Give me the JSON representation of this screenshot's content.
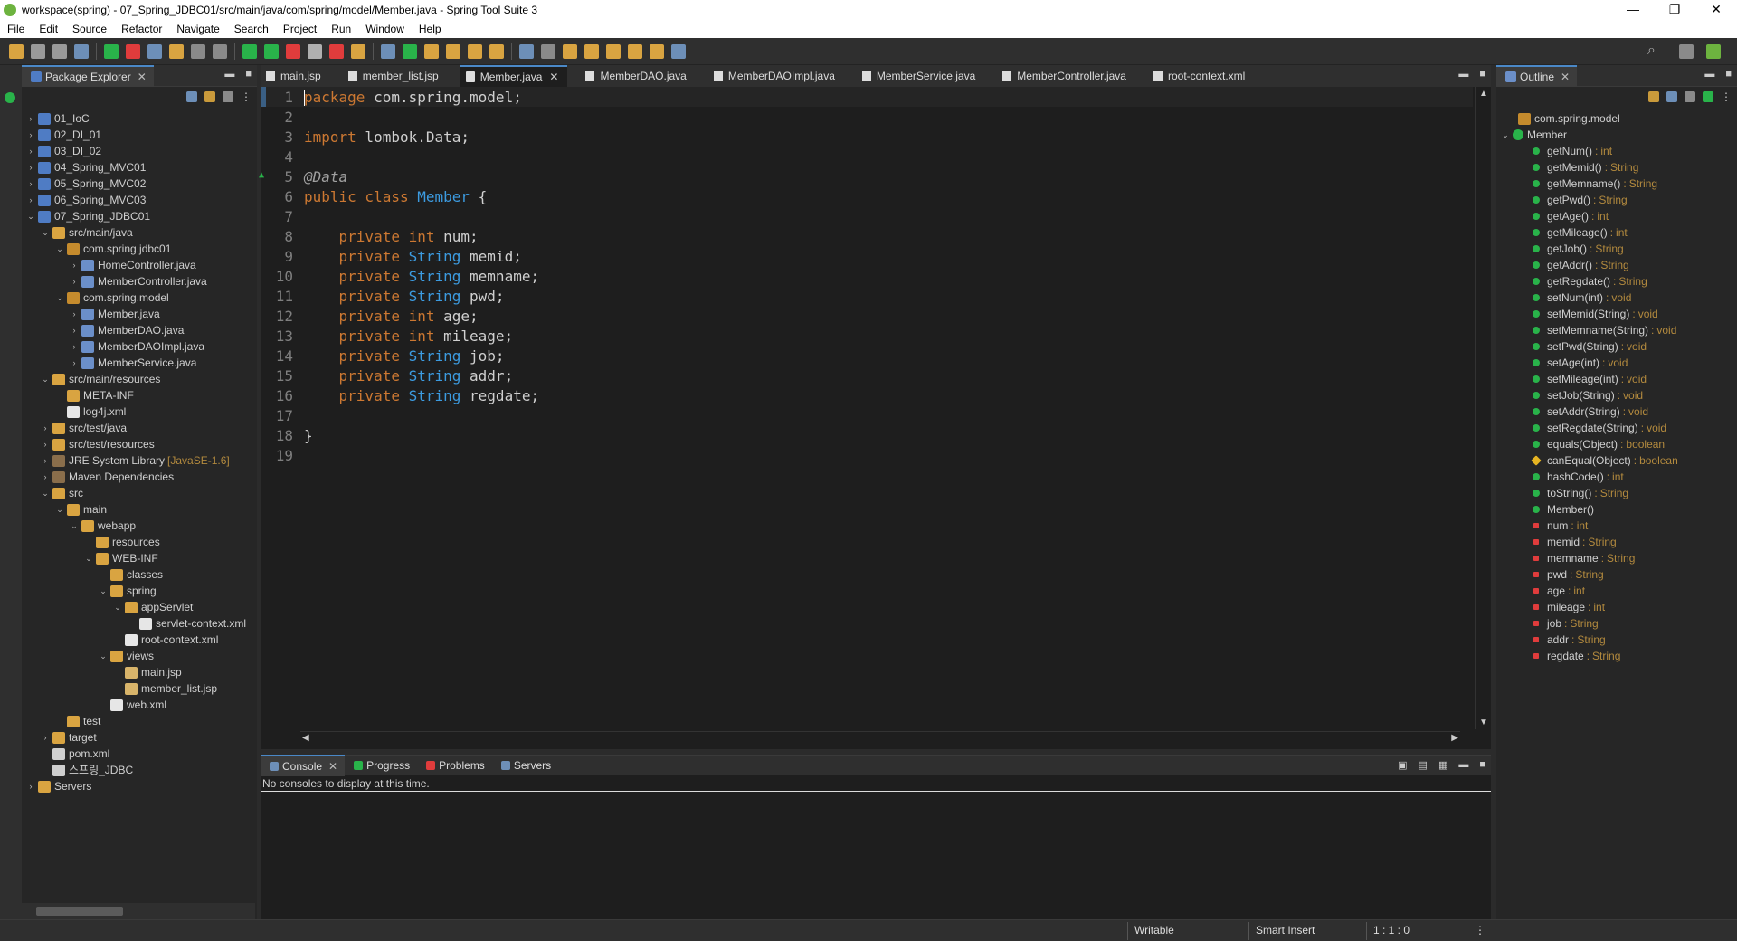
{
  "window": {
    "title": "workspace(spring) - 07_Spring_JDBC01/src/main/java/com/spring/model/Member.java - Spring Tool Suite 3",
    "minimize": "—",
    "maximize": "❐",
    "close": "✕"
  },
  "menu": [
    "File",
    "Edit",
    "Source",
    "Refactor",
    "Navigate",
    "Search",
    "Project",
    "Run",
    "Window",
    "Help"
  ],
  "package_explorer": {
    "title": "Package Explorer",
    "items": [
      {
        "label": "01_IoC",
        "twisty": "›",
        "icon": "proj",
        "indent": 0
      },
      {
        "label": "02_DI_01",
        "twisty": "›",
        "icon": "proj",
        "indent": 0
      },
      {
        "label": "03_DI_02",
        "twisty": "›",
        "icon": "proj",
        "indent": 0
      },
      {
        "label": "04_Spring_MVC01",
        "twisty": "›",
        "icon": "proj",
        "indent": 0
      },
      {
        "label": "05_Spring_MVC02",
        "twisty": "›",
        "icon": "proj",
        "indent": 0
      },
      {
        "label": "06_Spring_MVC03",
        "twisty": "›",
        "icon": "proj",
        "indent": 0
      },
      {
        "label": "07_Spring_JDBC01",
        "twisty": "⌄",
        "icon": "proj",
        "indent": 0
      },
      {
        "label": "src/main/java",
        "twisty": "⌄",
        "icon": "folder",
        "indent": 1
      },
      {
        "label": "com.spring.jdbc01",
        "twisty": "⌄",
        "icon": "pkg",
        "indent": 2
      },
      {
        "label": "HomeController.java",
        "twisty": "›",
        "icon": "java",
        "indent": 3
      },
      {
        "label": "MemberController.java",
        "twisty": "›",
        "icon": "java",
        "indent": 3
      },
      {
        "label": "com.spring.model",
        "twisty": "⌄",
        "icon": "pkg",
        "indent": 2
      },
      {
        "label": "Member.java",
        "twisty": "›",
        "icon": "java",
        "indent": 3
      },
      {
        "label": "MemberDAO.java",
        "twisty": "›",
        "icon": "java",
        "indent": 3
      },
      {
        "label": "MemberDAOImpl.java",
        "twisty": "›",
        "icon": "java",
        "indent": 3
      },
      {
        "label": "MemberService.java",
        "twisty": "›",
        "icon": "java",
        "indent": 3
      },
      {
        "label": "src/main/resources",
        "twisty": "⌄",
        "icon": "folder",
        "indent": 1
      },
      {
        "label": "META-INF",
        "twisty": "",
        "icon": "folder",
        "indent": 2
      },
      {
        "label": "log4j.xml",
        "twisty": "",
        "icon": "xml",
        "indent": 2
      },
      {
        "label": "src/test/java",
        "twisty": "›",
        "icon": "folder",
        "indent": 1
      },
      {
        "label": "src/test/resources",
        "twisty": "›",
        "icon": "folder",
        "indent": 1
      },
      {
        "label": "JRE System Library",
        "suffix": "[JavaSE-1.6]",
        "twisty": "›",
        "icon": "lib",
        "indent": 1
      },
      {
        "label": "Maven Dependencies",
        "twisty": "›",
        "icon": "lib",
        "indent": 1
      },
      {
        "label": "src",
        "twisty": "⌄",
        "icon": "folder",
        "indent": 1
      },
      {
        "label": "main",
        "twisty": "⌄",
        "icon": "folder",
        "indent": 2
      },
      {
        "label": "webapp",
        "twisty": "⌄",
        "icon": "folder",
        "indent": 3
      },
      {
        "label": "resources",
        "twisty": "",
        "icon": "folder",
        "indent": 4
      },
      {
        "label": "WEB-INF",
        "twisty": "⌄",
        "icon": "folder",
        "indent": 4
      },
      {
        "label": "classes",
        "twisty": "",
        "icon": "folder",
        "indent": 5
      },
      {
        "label": "spring",
        "twisty": "⌄",
        "icon": "folder",
        "indent": 5
      },
      {
        "label": "appServlet",
        "twisty": "⌄",
        "icon": "folder",
        "indent": 6
      },
      {
        "label": "servlet-context.xml",
        "twisty": "",
        "icon": "xml",
        "indent": 7
      },
      {
        "label": "root-context.xml",
        "twisty": "",
        "icon": "xml",
        "indent": 6
      },
      {
        "label": "views",
        "twisty": "⌄",
        "icon": "folder",
        "indent": 5
      },
      {
        "label": "main.jsp",
        "twisty": "",
        "icon": "jsp",
        "indent": 6
      },
      {
        "label": "member_list.jsp",
        "twisty": "",
        "icon": "jsp",
        "indent": 6
      },
      {
        "label": "web.xml",
        "twisty": "",
        "icon": "xml",
        "indent": 5
      },
      {
        "label": "test",
        "twisty": "",
        "icon": "folder",
        "indent": 2
      },
      {
        "label": "target",
        "twisty": "›",
        "icon": "folder",
        "indent": 1
      },
      {
        "label": "pom.xml",
        "twisty": "",
        "icon": "file",
        "indent": 1
      },
      {
        "label": "스프링_JDBC",
        "twisty": "",
        "icon": "file",
        "indent": 1
      },
      {
        "label": "Servers",
        "twisty": "›",
        "icon": "folder",
        "indent": 0
      }
    ]
  },
  "editor": {
    "tabs": [
      {
        "label": "main.jsp",
        "active": false
      },
      {
        "label": "member_list.jsp",
        "active": false
      },
      {
        "label": "Member.java",
        "active": true
      },
      {
        "label": "MemberDAO.java",
        "active": false
      },
      {
        "label": "MemberDAOImpl.java",
        "active": false
      },
      {
        "label": "MemberService.java",
        "active": false
      },
      {
        "label": "MemberController.java",
        "active": false
      },
      {
        "label": "root-context.xml",
        "active": false
      }
    ],
    "lines": [
      {
        "n": "1",
        "parts": [
          [
            "kw",
            "package"
          ],
          [
            "tx",
            " com.spring.model;"
          ]
        ]
      },
      {
        "n": "2",
        "parts": []
      },
      {
        "n": "3",
        "parts": [
          [
            "kw",
            "import"
          ],
          [
            "tx",
            " lombok.Data;"
          ]
        ]
      },
      {
        "n": "4",
        "parts": []
      },
      {
        "n": "5",
        "parts": [
          [
            "an",
            "@Data"
          ]
        ]
      },
      {
        "n": "6",
        "parts": [
          [
            "kw",
            "public class "
          ],
          [
            "ty",
            "Member"
          ],
          [
            "tx",
            " {"
          ]
        ]
      },
      {
        "n": "7",
        "parts": []
      },
      {
        "n": "8",
        "parts": [
          [
            "tx",
            "    "
          ],
          [
            "kw",
            "private "
          ],
          [
            "kw",
            "int "
          ],
          [
            "tx",
            "num;"
          ]
        ]
      },
      {
        "n": "9",
        "parts": [
          [
            "tx",
            "    "
          ],
          [
            "kw",
            "private "
          ],
          [
            "ty",
            "String "
          ],
          [
            "tx",
            "memid;"
          ]
        ]
      },
      {
        "n": "10",
        "parts": [
          [
            "tx",
            "    "
          ],
          [
            "kw",
            "private "
          ],
          [
            "ty",
            "String "
          ],
          [
            "tx",
            "memname;"
          ]
        ]
      },
      {
        "n": "11",
        "parts": [
          [
            "tx",
            "    "
          ],
          [
            "kw",
            "private "
          ],
          [
            "ty",
            "String "
          ],
          [
            "tx",
            "pwd;"
          ]
        ]
      },
      {
        "n": "12",
        "parts": [
          [
            "tx",
            "    "
          ],
          [
            "kw",
            "private "
          ],
          [
            "kw",
            "int "
          ],
          [
            "tx",
            "age;"
          ]
        ]
      },
      {
        "n": "13",
        "parts": [
          [
            "tx",
            "    "
          ],
          [
            "kw",
            "private "
          ],
          [
            "kw",
            "int "
          ],
          [
            "tx",
            "mileage;"
          ]
        ]
      },
      {
        "n": "14",
        "parts": [
          [
            "tx",
            "    "
          ],
          [
            "kw",
            "private "
          ],
          [
            "ty",
            "String "
          ],
          [
            "tx",
            "job;"
          ]
        ]
      },
      {
        "n": "15",
        "parts": [
          [
            "tx",
            "    "
          ],
          [
            "kw",
            "private "
          ],
          [
            "ty",
            "String "
          ],
          [
            "tx",
            "addr;"
          ]
        ]
      },
      {
        "n": "16",
        "parts": [
          [
            "tx",
            "    "
          ],
          [
            "kw",
            "private "
          ],
          [
            "ty",
            "String "
          ],
          [
            "tx",
            "regdate;"
          ]
        ]
      },
      {
        "n": "17",
        "parts": []
      },
      {
        "n": "18",
        "parts": [
          [
            "tx",
            "}"
          ]
        ]
      },
      {
        "n": "19",
        "parts": []
      }
    ]
  },
  "console": {
    "tabs": [
      "Console",
      "Progress",
      "Problems",
      "Servers"
    ],
    "message": "No consoles to display at this time."
  },
  "outline": {
    "title": "Outline",
    "package": "com.spring.model",
    "class_name": "Member",
    "members": [
      {
        "name": "getNum()",
        "type": "int",
        "vis": "pub"
      },
      {
        "name": "getMemid()",
        "type": "String",
        "vis": "pub"
      },
      {
        "name": "getMemname()",
        "type": "String",
        "vis": "pub"
      },
      {
        "name": "getPwd()",
        "type": "String",
        "vis": "pub"
      },
      {
        "name": "getAge()",
        "type": "int",
        "vis": "pub"
      },
      {
        "name": "getMileage()",
        "type": "int",
        "vis": "pub"
      },
      {
        "name": "getJob()",
        "type": "String",
        "vis": "pub"
      },
      {
        "name": "getAddr()",
        "type": "String",
        "vis": "pub"
      },
      {
        "name": "getRegdate()",
        "type": "String",
        "vis": "pub"
      },
      {
        "name": "setNum(int)",
        "type": "void",
        "vis": "pub"
      },
      {
        "name": "setMemid(String)",
        "type": "void",
        "vis": "pub"
      },
      {
        "name": "setMemname(String)",
        "type": "void",
        "vis": "pub"
      },
      {
        "name": "setPwd(String)",
        "type": "void",
        "vis": "pub"
      },
      {
        "name": "setAge(int)",
        "type": "void",
        "vis": "pub"
      },
      {
        "name": "setMileage(int)",
        "type": "void",
        "vis": "pub"
      },
      {
        "name": "setJob(String)",
        "type": "void",
        "vis": "pub"
      },
      {
        "name": "setAddr(String)",
        "type": "void",
        "vis": "pub"
      },
      {
        "name": "setRegdate(String)",
        "type": "void",
        "vis": "pub"
      },
      {
        "name": "equals(Object)",
        "type": "boolean",
        "vis": "pub"
      },
      {
        "name": "canEqual(Object)",
        "type": "boolean",
        "vis": "prot"
      },
      {
        "name": "hashCode()",
        "type": "int",
        "vis": "pub"
      },
      {
        "name": "toString()",
        "type": "String",
        "vis": "pub"
      },
      {
        "name": "Member()",
        "type": "",
        "vis": "pub"
      },
      {
        "name": "num",
        "type": "int",
        "vis": "priv"
      },
      {
        "name": "memid",
        "type": "String",
        "vis": "priv"
      },
      {
        "name": "memname",
        "type": "String",
        "vis": "priv"
      },
      {
        "name": "pwd",
        "type": "String",
        "vis": "priv"
      },
      {
        "name": "age",
        "type": "int",
        "vis": "priv"
      },
      {
        "name": "mileage",
        "type": "int",
        "vis": "priv"
      },
      {
        "name": "job",
        "type": "String",
        "vis": "priv"
      },
      {
        "name": "addr",
        "type": "String",
        "vis": "priv"
      },
      {
        "name": "regdate",
        "type": "String",
        "vis": "priv"
      }
    ]
  },
  "status": {
    "writable": "Writable",
    "insert_mode": "Smart Insert",
    "position": "1 : 1 : 0"
  },
  "colors": {
    "keyword": "#cc7832",
    "type": "#3c9be0",
    "annotation": "#a0a0a0",
    "accent": "#4a88c7"
  }
}
